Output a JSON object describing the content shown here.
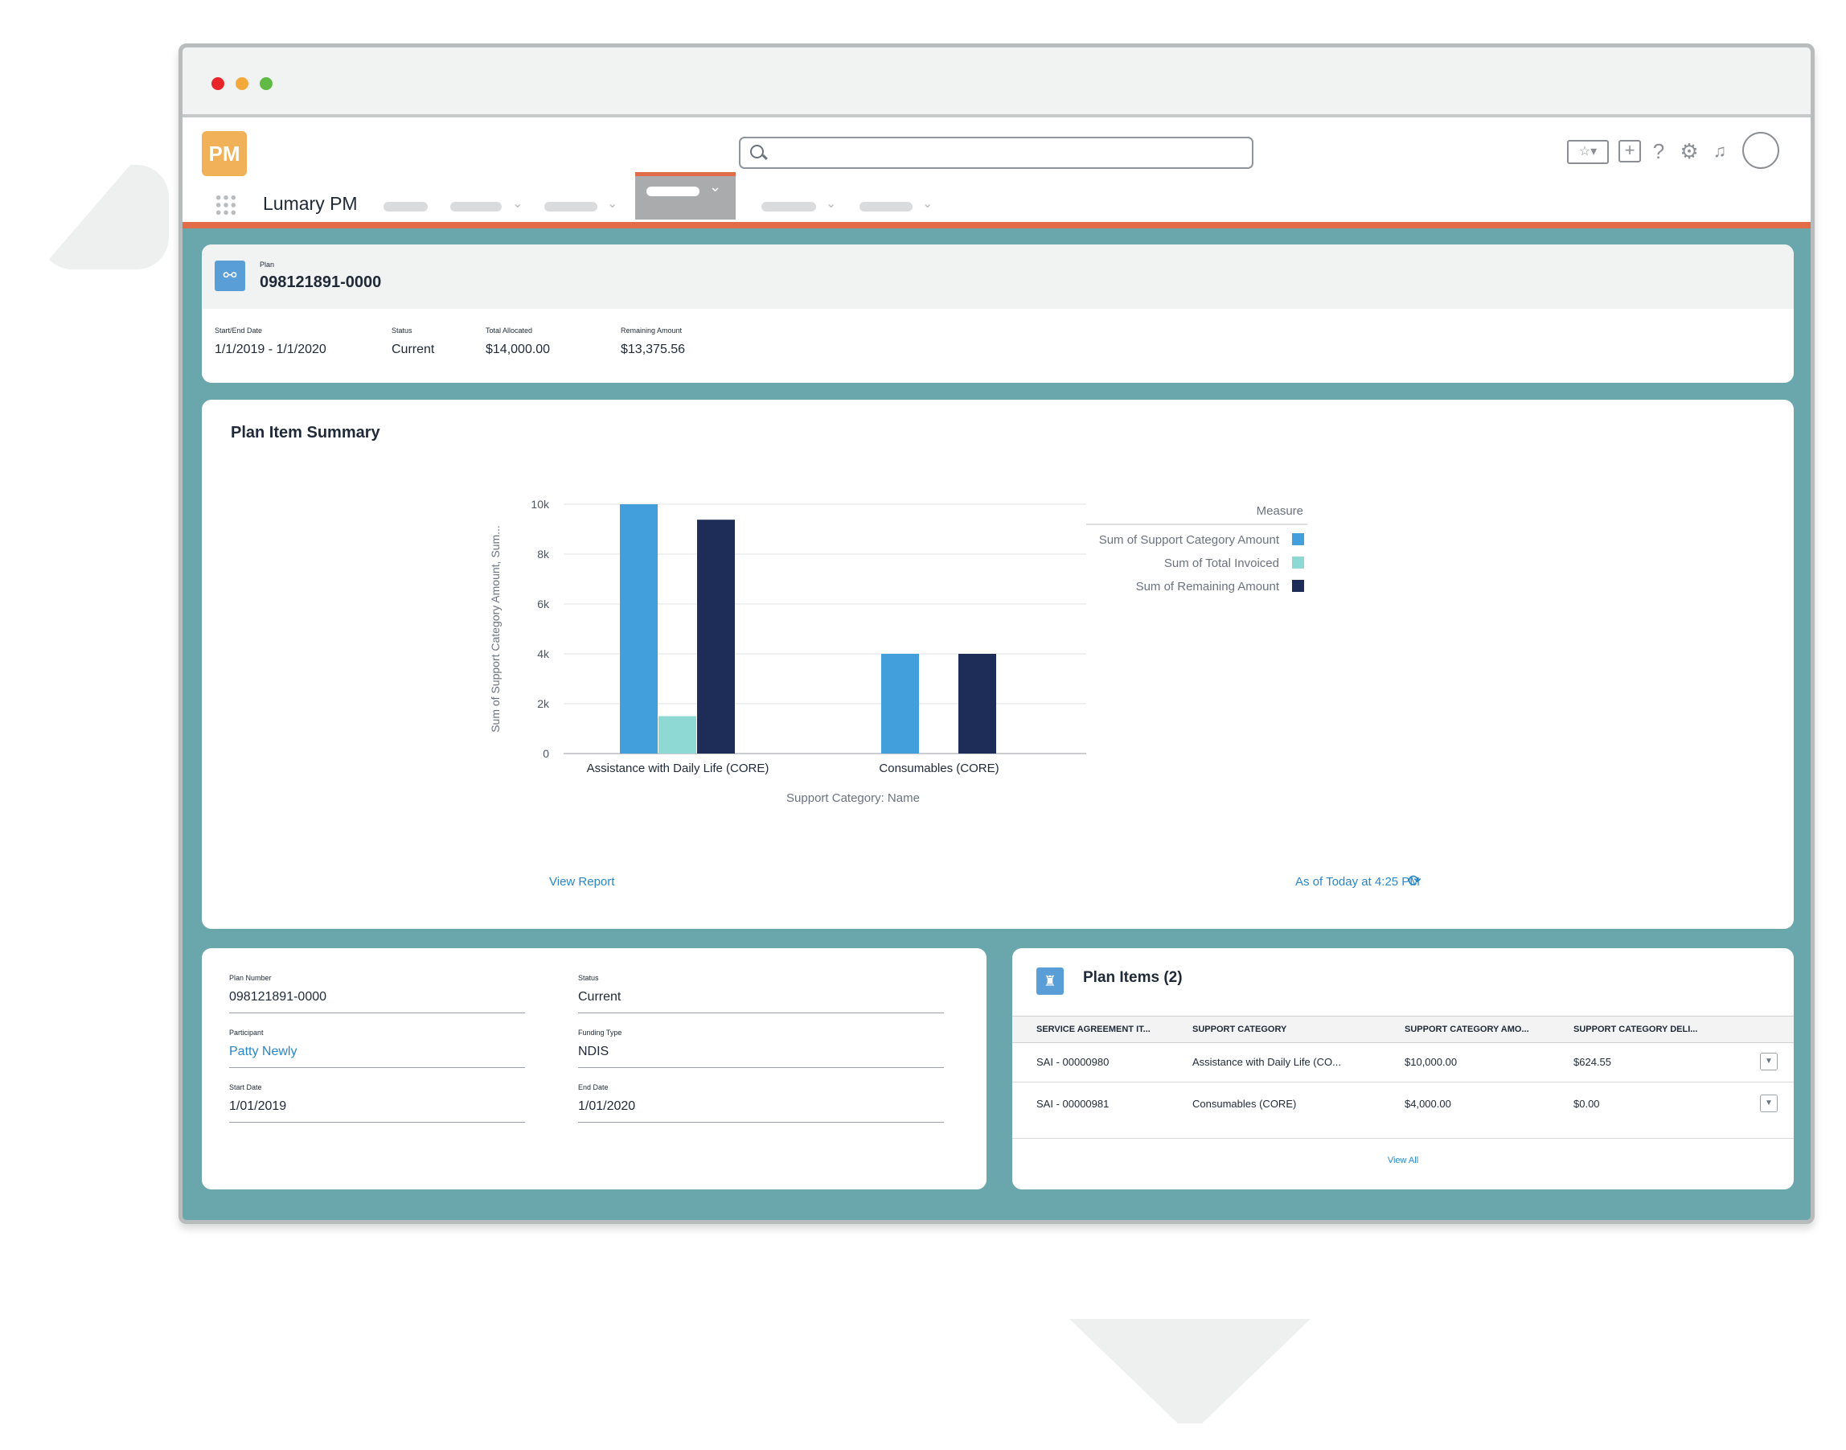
{
  "app": {
    "logo_text": "PM",
    "name": "Lumary PM"
  },
  "header_icons": [
    "favorites-icon",
    "add-icon",
    "help-icon",
    "settings-icon",
    "notifications-icon",
    "avatar"
  ],
  "plan_header": {
    "record_type": "Plan",
    "plan_number": "098121891-0000",
    "fields": [
      {
        "label": "Start/End Date",
        "value": "1/1/2019 - 1/1/2020"
      },
      {
        "label": "Status",
        "value": "Current"
      },
      {
        "label": "Total Allocated",
        "value": "$14,000.00"
      },
      {
        "label": "Remaining Amount",
        "value": "$13,375.56"
      }
    ]
  },
  "summary": {
    "title": "Plan Item Summary",
    "view_report": "View Report",
    "as_of": "As of Today at 4:25 PM"
  },
  "chart_data": {
    "type": "bar",
    "categories": [
      "Assistance with Daily Life (CORE)",
      "Consumables (CORE)"
    ],
    "series": [
      {
        "name": "Sum of Support Category Amount",
        "color": "#439fdb",
        "values": [
          10000,
          4000
        ]
      },
      {
        "name": "Sum of Total Invoiced",
        "color": "#8fd9d5",
        "values": [
          1500,
          0
        ]
      },
      {
        "name": "Sum of Remaining Amount",
        "color": "#1d2d57",
        "values": [
          9380,
          4000
        ]
      }
    ],
    "xlabel": "Support Category: Name",
    "ylabel": "Sum of Support Category Amount, Sum...",
    "yticks": [
      "0",
      "2k",
      "4k",
      "6k",
      "8k",
      "10k"
    ],
    "ylim": [
      0,
      10000
    ],
    "legend_title": "Measure",
    "legend_position": "top-right",
    "grid": true
  },
  "details": {
    "fields": [
      {
        "label": "Plan Number",
        "value": "098121891-0000"
      },
      {
        "label": "Status",
        "value": "Current"
      },
      {
        "label": "Participant",
        "value": "Patty Newly"
      },
      {
        "label": "Funding Type",
        "value": "NDIS"
      },
      {
        "label": "Start Date",
        "value": "1/01/2019"
      },
      {
        "label": "End Date",
        "value": "1/01/2020"
      }
    ]
  },
  "plan_items": {
    "title": "Plan Items (2)",
    "columns": [
      "SERVICE AGREEMENT IT...",
      "SUPPORT CATEGORY",
      "SUPPORT CATEGORY AMO...",
      "SUPPORT CATEGORY DELI..."
    ],
    "rows": [
      [
        "SAI - 00000980",
        "Assistance with Daily Life (CO...",
        "$10,000.00",
        "$624.55"
      ],
      [
        "SAI - 00000981",
        "Consumables (CORE)",
        "$4,000.00",
        "$0.00"
      ]
    ],
    "view_all": "View All"
  }
}
